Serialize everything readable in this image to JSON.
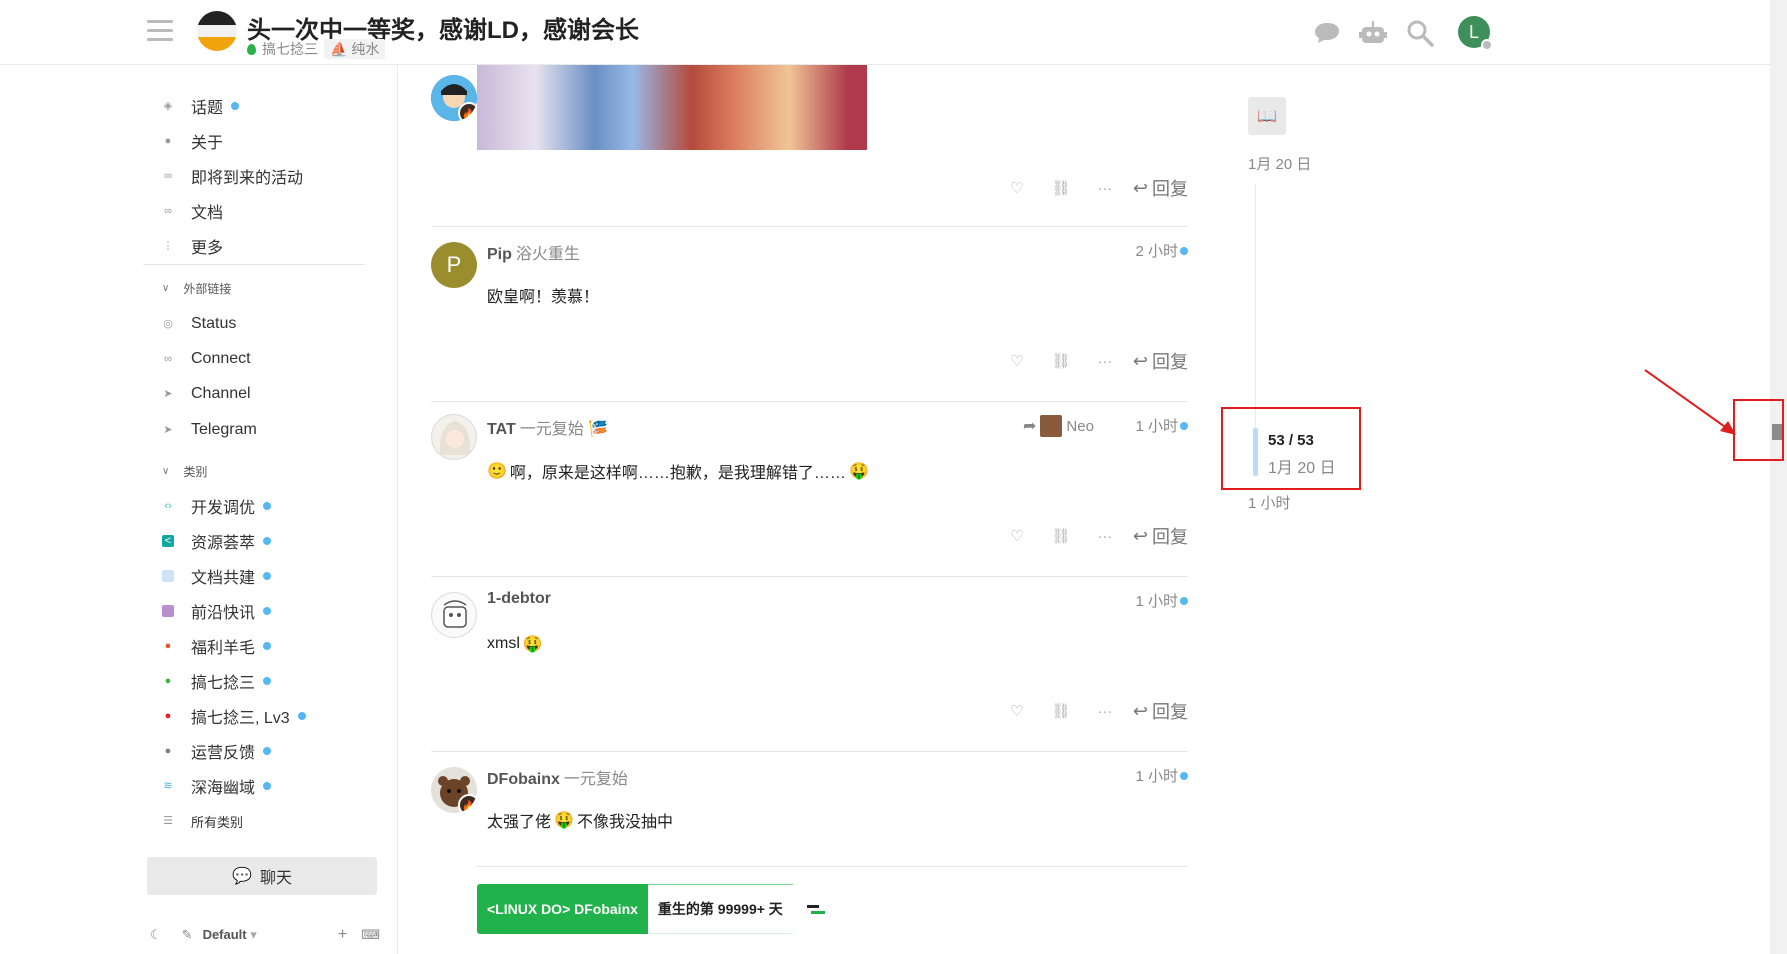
{
  "header": {
    "title": "头一次中一等奖，感谢LD，感谢会长",
    "category": "搞七捻三",
    "tag": "纯水",
    "user_initial": "L"
  },
  "sidebar": {
    "main": [
      {
        "label": "话题",
        "icon": "layers-icon",
        "dot": true
      },
      {
        "label": "关于",
        "icon": "info-icon",
        "dot": false
      },
      {
        "label": "即将到来的活动",
        "icon": "link-icon",
        "dot": false
      },
      {
        "label": "文档",
        "icon": "link-icon",
        "dot": false
      },
      {
        "label": "更多",
        "icon": "more-vertical-icon",
        "dot": false
      }
    ],
    "external_header": "外部链接",
    "external": [
      {
        "label": "Status",
        "icon": "eye-icon"
      },
      {
        "label": "Connect",
        "icon": "link-icon"
      },
      {
        "label": "Channel",
        "icon": "send-icon"
      },
      {
        "label": "Telegram",
        "icon": "send-icon"
      }
    ],
    "categories_header": "类别",
    "categories": [
      {
        "label": "开发调优",
        "color": "#32c3c3"
      },
      {
        "label": "资源荟萃",
        "color": "#12a89d"
      },
      {
        "label": "文档共建",
        "color": "#9cc7ee"
      },
      {
        "label": "前沿快讯",
        "color": "#bb8fce"
      },
      {
        "label": "福利羊毛",
        "color": "#e45735"
      },
      {
        "label": "搞七捻三",
        "color": "#3ab54a"
      },
      {
        "label": "搞七捻三, Lv3",
        "color": "#ed1c24"
      },
      {
        "label": "运营反馈",
        "color": "#808281"
      },
      {
        "label": "深海幽域",
        "color": "#45b5d8"
      }
    ],
    "all_categories": "所有类别",
    "chat_label": "聊天",
    "theme_label": "Default"
  },
  "posts": [
    {
      "name": "Pip",
      "title": "浴火重生",
      "time": "2 小时",
      "body": "欧皇啊！羡慕！"
    },
    {
      "name": "TAT",
      "title": "一元复始",
      "reply_to": "Neo",
      "time": "1 小时",
      "body": "啊，原来是这样啊……抱歉，是我理解错了……"
    },
    {
      "name": "1-debtor",
      "title": "",
      "time": "1 小时",
      "body": "xmsl"
    },
    {
      "name": "DFobainx",
      "title": "一元复始",
      "time": "1 小时",
      "body_before": "太强了佬",
      "body_after": "不像我没抽中"
    }
  ],
  "reply_label": "回复",
  "signature": {
    "left": "<LINUX DO> DFobainx",
    "right": "重生的第 99999+ 天"
  },
  "timeline": {
    "start_date": "1月 20 日",
    "position": "53 / 53",
    "current_date": "1月 20 日",
    "end_label": "1 小时"
  }
}
